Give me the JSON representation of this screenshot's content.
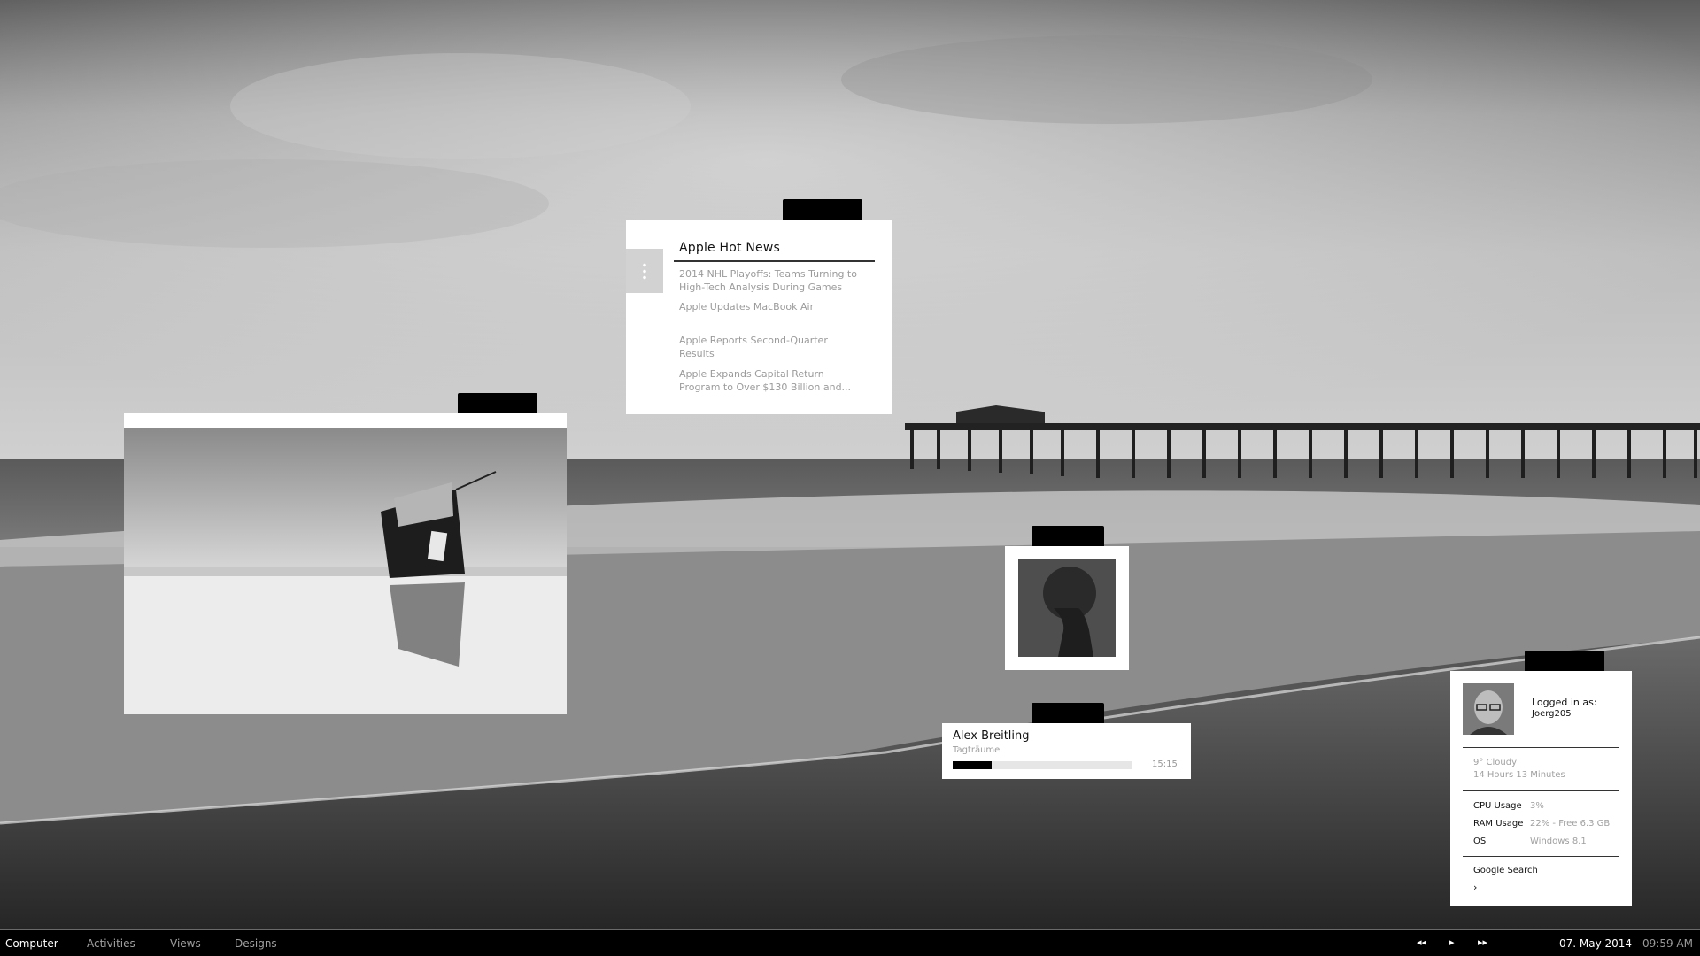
{
  "news": {
    "title": "Apple Hot News",
    "items": [
      "2014 NHL Playoffs: Teams Turning to High-Tech Analysis During Games",
      "Apple Updates MacBook Air",
      "Apple Reports Second-Quarter Results",
      "Apple Expands Capital Return Program to Over $130 Billion and..."
    ]
  },
  "player": {
    "artist": "Alex Breitling",
    "track": "Tagträume",
    "time": "15:15",
    "progress": 0.22
  },
  "system": {
    "logged_in_label": "Logged in as:",
    "username": "Joerg205",
    "weather": "9°  Cloudy",
    "uptime": "14 Hours 13 Minutes",
    "cpu_label": "CPU Usage",
    "cpu_value": "3%",
    "ram_label": "RAM Usage",
    "ram_value": "22% - Free 6.3 GB",
    "os_label": "OS",
    "os_value": "Windows 8.1",
    "search_label": "Google Search",
    "search_go": "›"
  },
  "taskbar": {
    "nav": [
      "Computer",
      "Activities",
      "Views",
      "Designs"
    ],
    "active": "Computer",
    "controls": {
      "prev": "◂◂",
      "play": "▸",
      "next": "▸▸"
    },
    "date": "07. May 2014 -",
    "time": " 09:59 AM"
  },
  "icons": {
    "handle": "vertical-dots-icon",
    "prev": "previous-icon",
    "play": "play-icon",
    "next": "next-icon"
  }
}
